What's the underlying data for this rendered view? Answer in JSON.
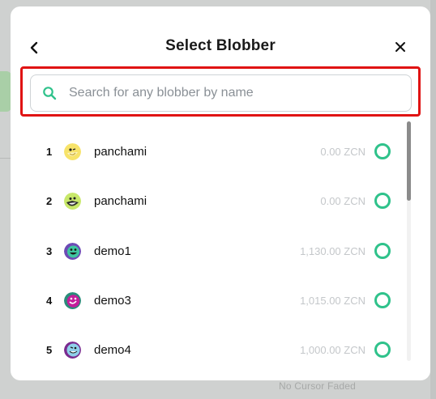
{
  "dialog": {
    "title": "Select Blobber",
    "back_icon": "chevron-left-icon",
    "close_icon": "close-icon"
  },
  "search": {
    "icon": "search-icon",
    "value": "",
    "placeholder": "Search for any blobber by name"
  },
  "colors": {
    "accent_green": "#2fc28b",
    "highlight_red": "#e01313",
    "muted_text": "#c4c7ca"
  },
  "blobbers": [
    {
      "rank": "1",
      "name": "panchami",
      "balance": "0.00 ZCN",
      "avatar": "yellow-smiley-avatar",
      "selected": false
    },
    {
      "rank": "2",
      "name": "panchami",
      "balance": "0.00 ZCN",
      "avatar": "lime-smiley-avatar",
      "selected": false
    },
    {
      "rank": "3",
      "name": "demo1",
      "balance": "1,130.00 ZCN",
      "avatar": "purple-teal-smiley-avatar",
      "selected": false
    },
    {
      "rank": "4",
      "name": "demo3",
      "balance": "1,015.00 ZCN",
      "avatar": "magenta-smiley-avatar",
      "selected": false
    },
    {
      "rank": "5",
      "name": "demo4",
      "balance": "1,000.00 ZCN",
      "avatar": "blue-smiley-avatar",
      "selected": false
    }
  ],
  "background": {
    "footer_text": "No Cursor Faded"
  }
}
